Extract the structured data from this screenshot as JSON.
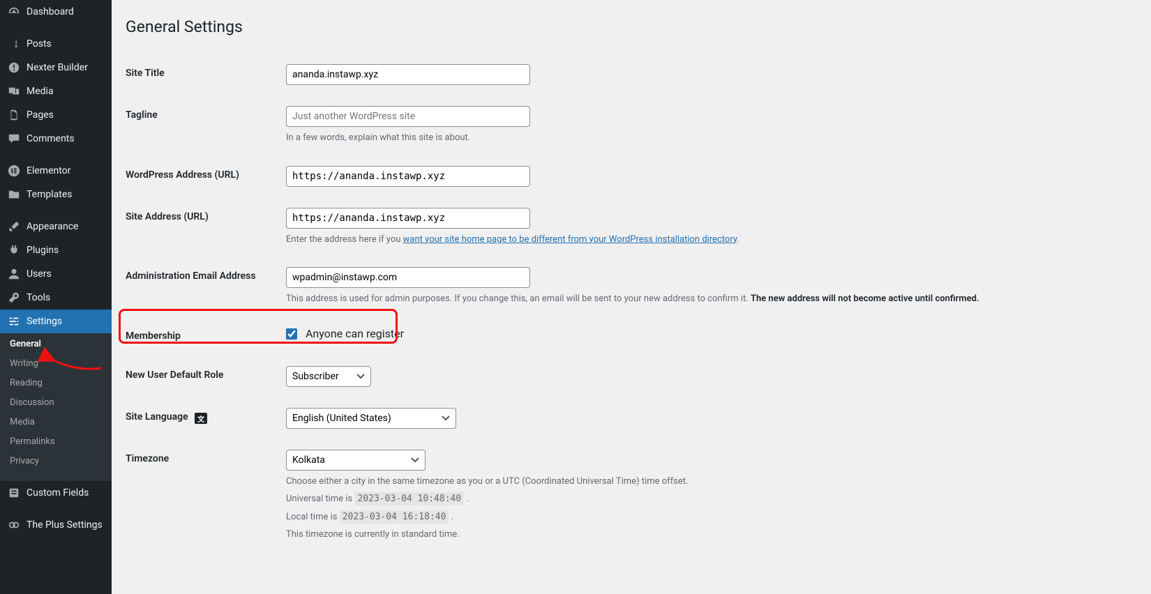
{
  "sidebar": {
    "items": [
      {
        "icon": "dashboard",
        "label": "Dashboard"
      },
      {
        "sep": true
      },
      {
        "icon": "pin",
        "label": "Posts"
      },
      {
        "icon": "bang",
        "label": "Nexter Builder"
      },
      {
        "icon": "media",
        "label": "Media"
      },
      {
        "icon": "page",
        "label": "Pages"
      },
      {
        "icon": "comment",
        "label": "Comments"
      },
      {
        "sep": true
      },
      {
        "icon": "elementor",
        "label": "Elementor"
      },
      {
        "icon": "folder",
        "label": "Templates"
      },
      {
        "sep": true
      },
      {
        "icon": "brush",
        "label": "Appearance"
      },
      {
        "icon": "plug",
        "label": "Plugins"
      },
      {
        "icon": "user",
        "label": "Users"
      },
      {
        "icon": "wrench",
        "label": "Tools"
      },
      {
        "icon": "sliders",
        "label": "Settings",
        "current": true
      }
    ],
    "submenu": [
      {
        "label": "General",
        "on": true
      },
      {
        "label": "Writing"
      },
      {
        "label": "Reading"
      },
      {
        "label": "Discussion"
      },
      {
        "label": "Media"
      },
      {
        "label": "Permalinks"
      },
      {
        "label": "Privacy"
      }
    ],
    "tail": [
      {
        "icon": "box",
        "label": "Custom Fields"
      },
      {
        "sep": true
      },
      {
        "icon": "plus",
        "label": "The Plus Settings"
      }
    ]
  },
  "page": {
    "title": "General Settings",
    "site_title_label": "Site Title",
    "site_title_value": "ananda.instawp.xyz",
    "tagline_label": "Tagline",
    "tagline_placeholder": "Just another WordPress site",
    "tagline_desc": "In a few words, explain what this site is about.",
    "wpurl_label": "WordPress Address (URL)",
    "wpurl_value": "https://ananda.instawp.xyz",
    "siteurl_label": "Site Address (URL)",
    "siteurl_value": "https://ananda.instawp.xyz",
    "siteurl_desc_pre": "Enter the address here if you ",
    "siteurl_desc_link": "want your site home page to be different from your WordPress installation directory",
    "siteurl_desc_post": ".",
    "email_label": "Administration Email Address",
    "email_value": "wpadmin@instawp.com",
    "email_desc_pre": "This address is used for admin purposes. If you change this, an email will be sent to your new address to confirm it. ",
    "email_desc_strong": "The new address will not become active until confirmed.",
    "membership_label": "Membership",
    "membership_check": "Anyone can register",
    "role_label": "New User Default Role",
    "role_value": "Subscriber",
    "lang_label": "Site Language",
    "lang_value": "English (United States)",
    "tz_label": "Timezone",
    "tz_value": "Kolkata",
    "tz_desc": "Choose either a city in the same timezone as you or a UTC (Coordinated Universal Time) time offset.",
    "tz_utc_pre": "Universal time is ",
    "tz_utc_val": "2023-03-04 10:48:40",
    "tz_loc_pre": "Local time is ",
    "tz_loc_val": "2023-03-04 16:18:40",
    "tz_dst": "This timezone is currently in standard time."
  }
}
